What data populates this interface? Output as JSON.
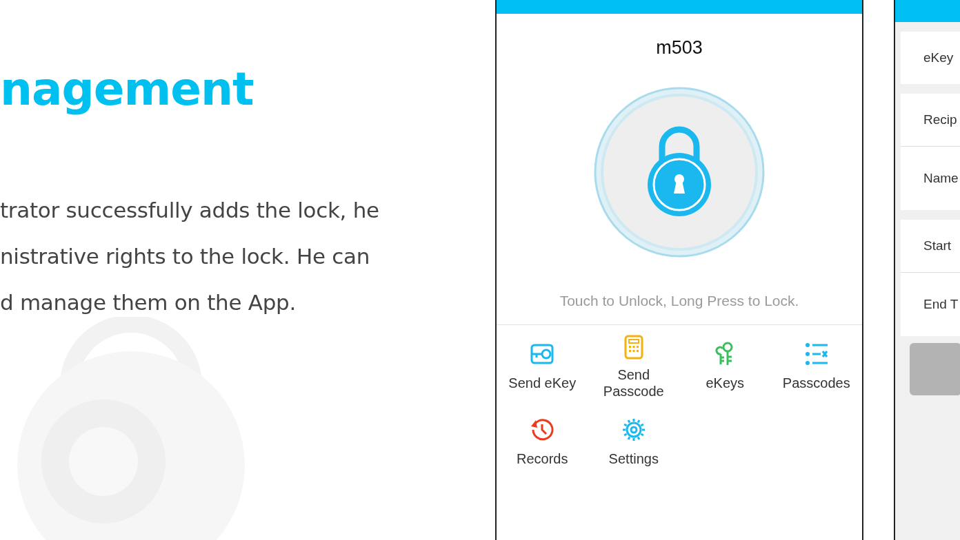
{
  "slide": {
    "title": "nagement",
    "body_lines": [
      "trator successfully adds the lock, he",
      "nistrative rights to the lock. He can",
      "d manage them on the App."
    ]
  },
  "lock_screen": {
    "lock_name": "m503",
    "hint": "Touch to Unlock, Long Press to Lock.",
    "actions": [
      {
        "kind": "send-ekey",
        "label": "Send eKey",
        "color": "#1ab8ee"
      },
      {
        "kind": "send-passcode",
        "label": "Send\nPasscode",
        "color": "#f2b211"
      },
      {
        "kind": "ekeys",
        "label": "eKeys",
        "color": "#3bbf5c"
      },
      {
        "kind": "passcodes",
        "label": "Passcodes",
        "color": "#1ab8ee"
      },
      {
        "kind": "records",
        "label": "Records",
        "color": "#ee3a1c"
      },
      {
        "kind": "settings",
        "label": "Settings",
        "color": "#1ab8ee"
      }
    ]
  },
  "send_ekey_screen": {
    "rows": [
      {
        "label": "eKey",
        "group_start": true
      },
      {
        "label": "Recip",
        "group_start": true
      },
      {
        "label": "Name",
        "group_start": false
      },
      {
        "label": "Start",
        "group_start": true
      },
      {
        "label": "End T",
        "group_start": false
      }
    ]
  }
}
